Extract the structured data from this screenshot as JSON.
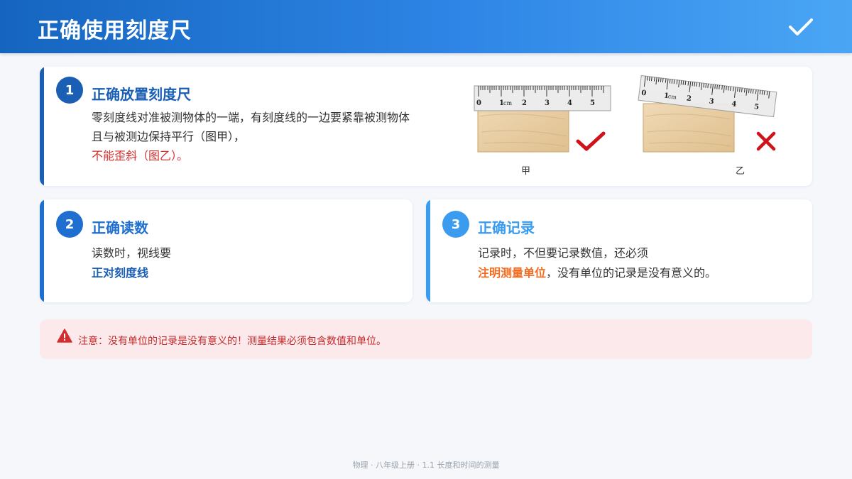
{
  "header": {
    "title": "正确使用刻度尺",
    "check_icon": "checkmark-icon"
  },
  "section1": {
    "number": "1",
    "title": "正确放置刻度尺",
    "line1": "零刻度线对准被测物体的一端，有刻度线的一边要紧靠被测物体",
    "line2": "且与被测边保持平行（图甲），",
    "line3": "不能歪斜（图乙）。",
    "figure_correct": {
      "label": "甲",
      "ruler_numbers": [
        "0",
        "1",
        "cm",
        "2",
        "3",
        "4",
        "5"
      ],
      "mark_icon": "check-mark-icon",
      "mark_color": "#d0121b"
    },
    "figure_wrong": {
      "label": "乙",
      "ruler_numbers": [
        "0",
        "1",
        "cm",
        "2",
        "3",
        "4",
        "5"
      ],
      "mark_icon": "cross-mark-icon",
      "mark_color": "#d0121b"
    }
  },
  "section2": {
    "number": "2",
    "title": "正确读数",
    "line1": "读数时，视线要",
    "line2": "正对刻度线"
  },
  "section3": {
    "number": "3",
    "title": "正确记录",
    "line1": "记录时，不但要记录数值，还必须",
    "line2_highlight": "注明测量单位",
    "line2_rest": "，没有单位的记录是没有意义的。"
  },
  "warning": {
    "icon": "warning-triangle-icon",
    "text": "注意：没有单位的记录是没有意义的！测量结果必须包含数值和单位。"
  },
  "footer": {
    "text": "物理 · 八年级上册 · 1.1 长度和时间的测量"
  },
  "colors": {
    "primary": "#1a5fb4",
    "accent_blue": "#3a9bef",
    "red": "#d32f2f",
    "orange": "#f36c21"
  }
}
